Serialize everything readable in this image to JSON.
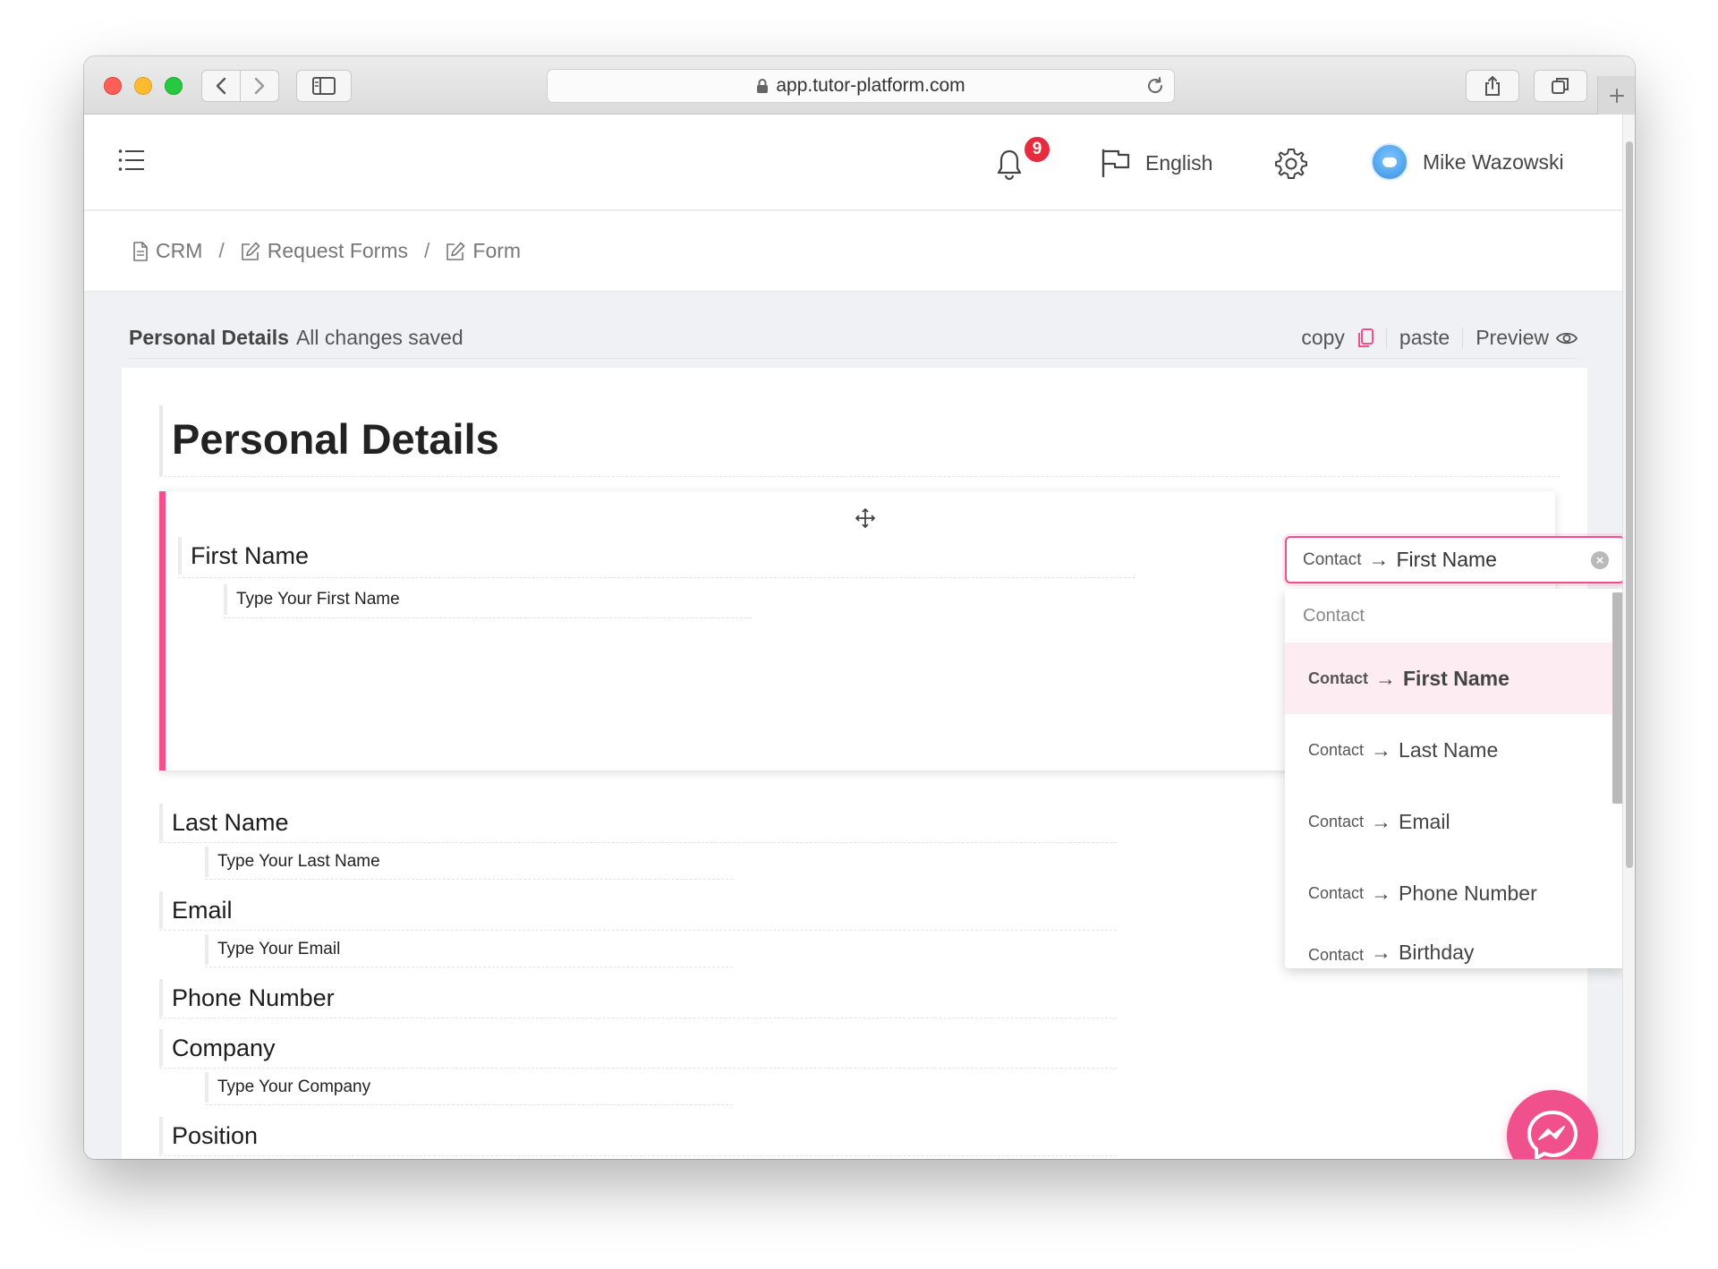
{
  "browser": {
    "url": "app.tutor-platform.com"
  },
  "header": {
    "notifications_count": "9",
    "language": "English",
    "user_name": "Mike Wazowski"
  },
  "breadcrumb": [
    {
      "label": "CRM",
      "icon": "document-icon"
    },
    {
      "label": "Request Forms",
      "icon": "edit-icon"
    },
    {
      "label": "Form",
      "icon": "edit-icon"
    }
  ],
  "breadcrumb_separator": "/",
  "status": {
    "section_title": "Personal Details",
    "save_state": "All changes saved",
    "copy_label": "copy",
    "paste_label": "paste",
    "preview_label": "Preview"
  },
  "form": {
    "title": "Personal Details",
    "fields": [
      {
        "label": "First Name",
        "placeholder": "Type Your First Name"
      },
      {
        "label": "Last Name",
        "placeholder": "Type Your Last Name"
      },
      {
        "label": "Email",
        "placeholder": "Type Your Email"
      },
      {
        "label": "Phone Number",
        "placeholder": ""
      },
      {
        "label": "Company",
        "placeholder": "Type Your Company"
      },
      {
        "label": "Position",
        "placeholder": ""
      }
    ]
  },
  "mapping": {
    "selected_prefix": "Contact",
    "arrow": "→",
    "selected_value": "First Name",
    "group_label": "Contact",
    "options": [
      {
        "prefix": "Contact",
        "label": "First Name",
        "selected": true
      },
      {
        "prefix": "Contact",
        "label": "Last Name",
        "selected": false
      },
      {
        "prefix": "Contact",
        "label": "Email",
        "selected": false
      },
      {
        "prefix": "Contact",
        "label": "Phone Number",
        "selected": false
      },
      {
        "prefix": "Contact",
        "label": "Birthday",
        "selected": false
      }
    ]
  },
  "colors": {
    "accent": "#f0508b",
    "badge": "#e82a3e",
    "selected_option_bg": "#fdecf1"
  }
}
